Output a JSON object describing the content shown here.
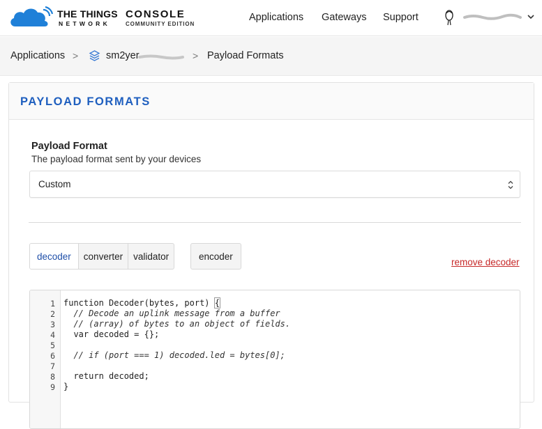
{
  "header": {
    "brand_line1": "THE THINGS",
    "brand_line2": "NETWORK",
    "console_title": "CONSOLE",
    "console_subtitle": "COMMUNITY EDITION",
    "nav": [
      "Applications",
      "Gateways",
      "Support"
    ],
    "brand_color": "#1f80d8"
  },
  "breadcrumb": {
    "root": "Applications",
    "app": "sm2yer",
    "current": "Payload Formats",
    "separator": ">"
  },
  "card": {
    "title": "PAYLOAD FORMATS",
    "field_label": "Payload Format",
    "field_description": "The payload format sent by your devices",
    "select_value": "Custom",
    "tabs": [
      "decoder",
      "converter",
      "validator"
    ],
    "active_tab": "decoder",
    "encoder_tab": "encoder",
    "remove_link": "remove decoder",
    "accent_color": "#1f5fbf",
    "danger_color": "#c62828"
  },
  "editor": {
    "line_numbers": [
      "1",
      "2",
      "3",
      "4",
      "5",
      "6",
      "7",
      "8",
      "9"
    ],
    "lines": [
      "function Decoder(bytes, port) ",
      "  // Decode an uplink message from a buffer",
      "  // (array) of bytes to an object of fields.",
      "  var decoded = {};",
      "",
      "  // if (port === 1) decoded.led = bytes[0];",
      "",
      "  return decoded;",
      "}"
    ],
    "open_brace": "{"
  }
}
